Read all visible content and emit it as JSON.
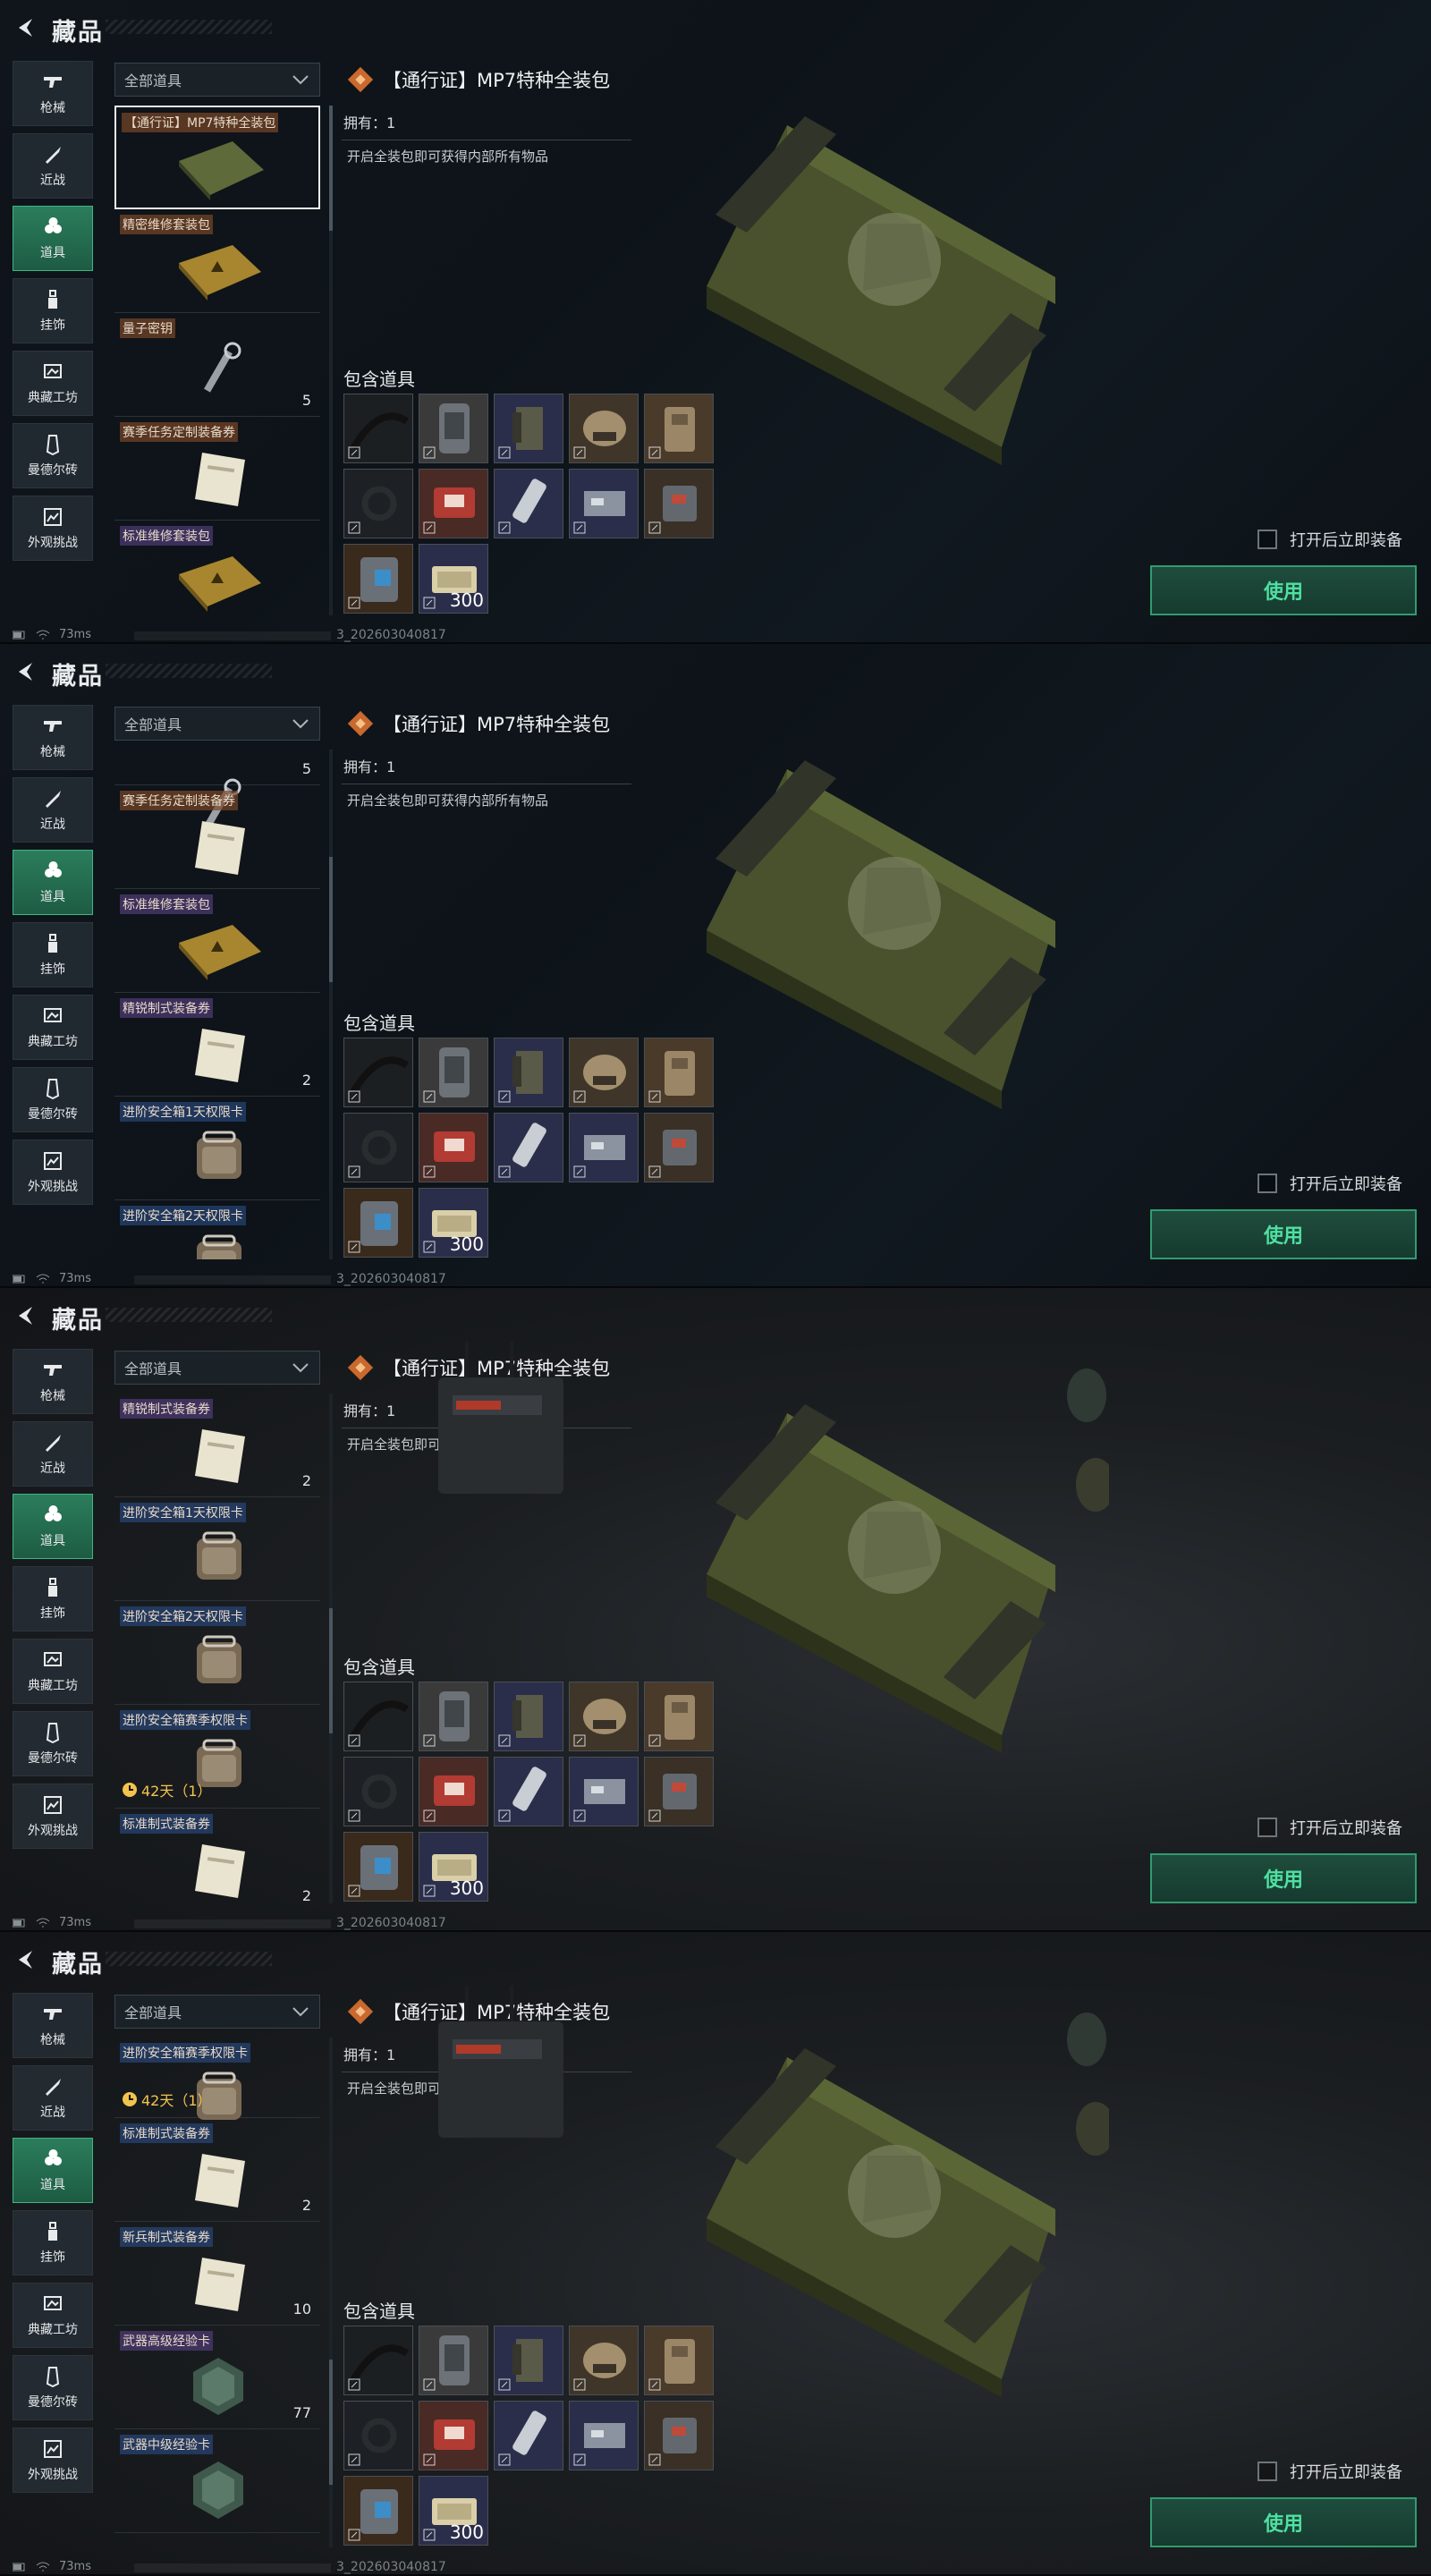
{
  "page": {
    "title": "藏品"
  },
  "colors": {
    "accent": "#2f9c6f",
    "accent_text": "#4fe0a2",
    "selected_tab": "#2b7d5c"
  },
  "sidebar": {
    "items": [
      {
        "label": "枪械",
        "icon": "gun-icon"
      },
      {
        "label": "近战",
        "icon": "knife-icon"
      },
      {
        "label": "道具",
        "icon": "items-icon",
        "active": true
      },
      {
        "label": "挂饰",
        "icon": "charm-icon"
      },
      {
        "label": "典藏工坊",
        "icon": "workshop-icon"
      },
      {
        "label": "曼德尔砖",
        "icon": "brick-icon"
      },
      {
        "label": "外观挑战",
        "icon": "challenge-icon"
      }
    ]
  },
  "filter": {
    "selected": "全部道具"
  },
  "detail": {
    "name": "【通行证】MP7特种全装包",
    "owned": "拥有：1",
    "description": "开启全装包即可获得内部所有物品",
    "included_label": "包含道具",
    "last_count": "300",
    "equip_label": "打开后立即装备",
    "use_label": "使用"
  },
  "status": {
    "ping": "73ms",
    "uid": "3_202603040817"
  },
  "screens": [
    {
      "items": [
        {
          "name": "【通行证】MP7特种全装包",
          "quality": "orange",
          "count": "",
          "timer": "",
          "selected": true,
          "thumb": "case"
        },
        {
          "name": "精密维修套装包",
          "quality": "orange",
          "count": "",
          "timer": "",
          "thumb": "kit"
        },
        {
          "name": "量子密钥",
          "quality": "orange",
          "count": "5",
          "timer": "",
          "thumb": "key"
        },
        {
          "name": "赛季任务定制装备券",
          "quality": "orange",
          "count": "",
          "timer": "",
          "thumb": "ticket"
        },
        {
          "name": "标准维修套装包",
          "quality": "purple",
          "count": "",
          "timer": "",
          "thumb": "kit"
        }
      ]
    },
    {
      "items": [
        {
          "name": "",
          "quality": "",
          "count": "5",
          "timer": "",
          "thumb": "key"
        },
        {
          "name": "赛季任务定制装备券",
          "quality": "orange",
          "count": "",
          "timer": "",
          "thumb": "ticket"
        },
        {
          "name": "标准维修套装包",
          "quality": "purple",
          "count": "",
          "timer": "",
          "thumb": "kit"
        },
        {
          "name": "精锐制式装备券",
          "quality": "purple",
          "count": "2",
          "timer": "",
          "thumb": "ticket"
        },
        {
          "name": "进阶安全箱1天权限卡",
          "quality": "blue",
          "count": "",
          "timer": "",
          "thumb": "safe"
        },
        {
          "name": "进阶安全箱2天权限卡",
          "quality": "blue",
          "count": "",
          "timer": "",
          "thumb": "safe"
        }
      ]
    },
    {
      "items": [
        {
          "name": "精锐制式装备券",
          "quality": "purple",
          "count": "2",
          "timer": "",
          "thumb": "ticket"
        },
        {
          "name": "进阶安全箱1天权限卡",
          "quality": "blue",
          "count": "",
          "timer": "",
          "thumb": "safe"
        },
        {
          "name": "进阶安全箱2天权限卡",
          "quality": "blue",
          "count": "",
          "timer": "",
          "thumb": "safe"
        },
        {
          "name": "进阶安全箱赛季权限卡",
          "quality": "blue",
          "count": "",
          "timer": "42天（1）",
          "thumb": "safe"
        },
        {
          "name": "标准制式装备券",
          "quality": "blue",
          "count": "2",
          "timer": "",
          "thumb": "ticket"
        }
      ]
    },
    {
      "items": [
        {
          "name": "进阶安全箱赛季权限卡",
          "quality": "blue",
          "count": "",
          "timer": "42天（1）",
          "thumb": "safe"
        },
        {
          "name": "标准制式装备券",
          "quality": "blue",
          "count": "2",
          "timer": "",
          "thumb": "ticket"
        },
        {
          "name": "新兵制式装备券",
          "quality": "blue",
          "count": "10",
          "timer": "",
          "thumb": "ticket"
        },
        {
          "name": "武器高级经验卡",
          "quality": "purple",
          "count": "77",
          "timer": "",
          "thumb": "card"
        },
        {
          "name": "武器中级经验卡",
          "quality": "blue",
          "count": "",
          "timer": "",
          "thumb": "card"
        }
      ]
    }
  ]
}
